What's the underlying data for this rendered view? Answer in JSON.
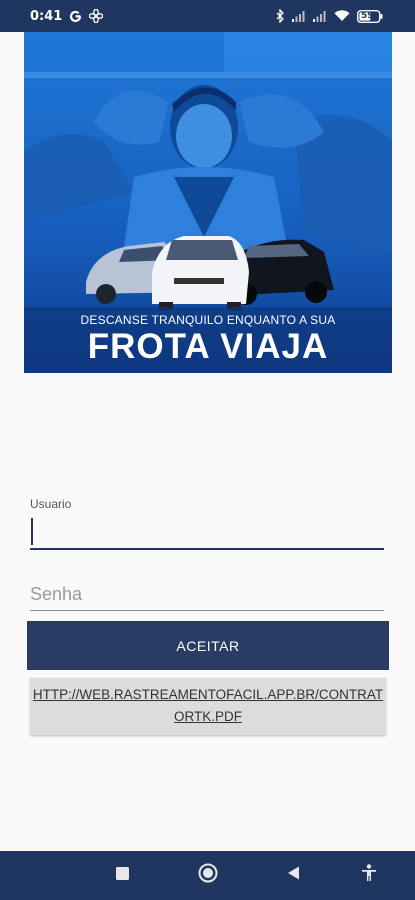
{
  "status_bar": {
    "time": "0:41",
    "icons_left": [
      "google-g-icon",
      "fan-icon"
    ],
    "icons_right": [
      "bluetooth-icon",
      "signal-icon",
      "signal-icon",
      "wifi-icon",
      "battery-icon"
    ],
    "battery": "59"
  },
  "banner": {
    "subtitle": "DESCANSE TRANQUILO ENQUANTO A SUA",
    "title": "FROTA VIAJA"
  },
  "form": {
    "username_label": "Usuario",
    "username_value": "",
    "password_placeholder": "Senha",
    "accept_button": "ACEITAR",
    "contract_link": "HTTP://WEB.RASTREAMENTOFACIL.APP.BR/CONTRATORTK.PDF"
  },
  "nav_bar": {
    "buttons": [
      "recents-square-icon",
      "home-circle-icon",
      "back-triangle-icon",
      "accessibility-icon"
    ]
  },
  "colors": {
    "primary": "#2a3c61",
    "nav": "#1f3660",
    "banner_blue": "#1f78d8"
  }
}
